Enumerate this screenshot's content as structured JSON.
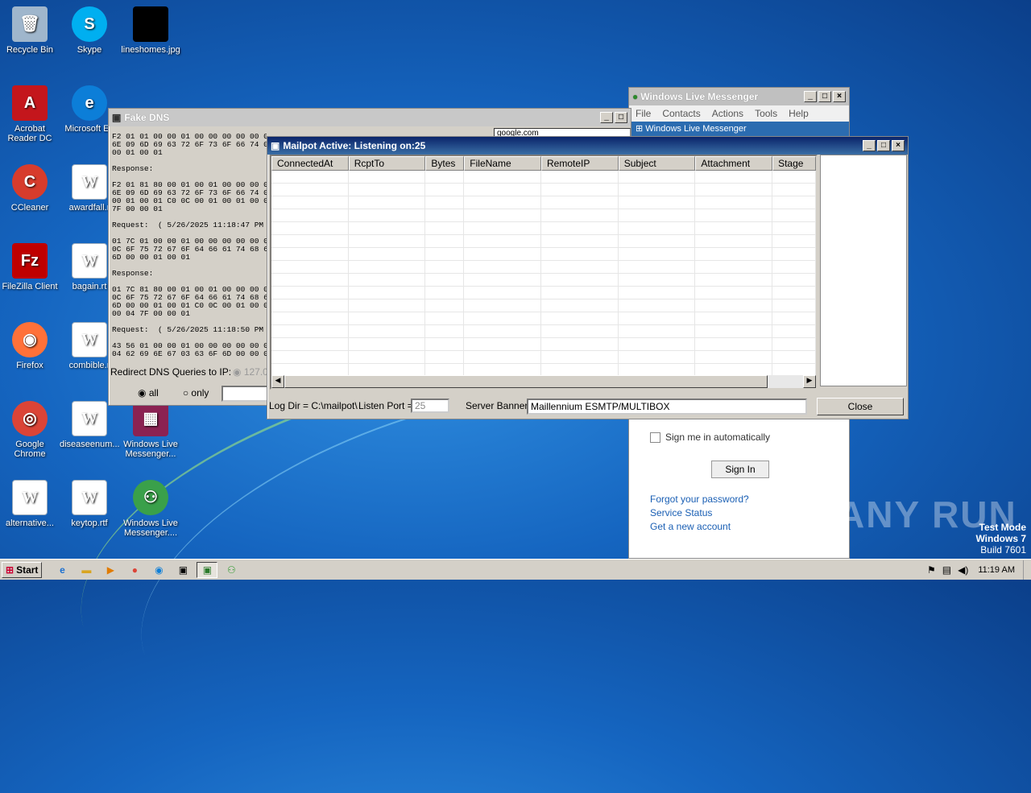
{
  "desktop_icons": [
    {
      "label": "Recycle Bin",
      "icon": "recycle-bin-icon"
    },
    {
      "label": "Skype",
      "icon": "skype-icon"
    },
    {
      "label": "lineshomes.jpg",
      "icon": "image-file-icon"
    },
    {
      "label": "Acrobat Reader DC",
      "icon": "acrobat-icon"
    },
    {
      "label": "Microsoft Ed",
      "icon": "edge-icon"
    },
    {
      "label": "CCleaner",
      "icon": "ccleaner-icon"
    },
    {
      "label": "awardfall.r",
      "icon": "word-doc-icon"
    },
    {
      "label": "FileZilla Client",
      "icon": "filezilla-icon"
    },
    {
      "label": "bagain.rt",
      "icon": "word-doc-icon"
    },
    {
      "label": "Firefox",
      "icon": "firefox-icon"
    },
    {
      "label": "combible.r",
      "icon": "word-doc-icon"
    },
    {
      "label": "Google Chrome",
      "icon": "chrome-icon"
    },
    {
      "label": "diseaseenum...",
      "icon": "word-doc-icon"
    },
    {
      "label": "Windows Live Messenger...",
      "icon": "winrar-icon"
    },
    {
      "label": "alternative...",
      "icon": "word-doc-icon"
    },
    {
      "label": "keytop.rtf",
      "icon": "word-doc-icon"
    },
    {
      "label": "Windows Live Messenger....",
      "icon": "messenger-icon"
    }
  ],
  "messenger": {
    "title": "Windows Live Messenger",
    "menu": [
      "File",
      "Contacts",
      "Actions",
      "Tools",
      "Help"
    ],
    "header": "Windows Live Messenger",
    "sign_in_auto": "Sign me in automatically",
    "sign_in_button": "Sign In",
    "links": [
      "Forgot your password?",
      "Service Status",
      "Get a new account"
    ]
  },
  "fakedns": {
    "title": "Fake DNS",
    "domain_field": "google.com",
    "log": "F2 01 01 00 00 01 00 00 00 00 00 00 06 67 6F\n6E 09 6D 69 63 72 6F 73 6F 66 74 03 63 6F 6D\n00 01 00 01\n\nResponse:\n\nF2 01 81 80 00 01 00 01 00 00 00 00 06 67 6F\n6E 09 6D 69 63 72 6F 73 6F 66 74 03 63 6F 6D\n00 01 00 01 C0 0C 00 01 00 01 00 00 00 3C 00\n7F 00 00 01\n\nRequest:  ( 5/26/2025 11:18:47 PM )\n\n01 7C 01 00 00 01 00 00 00 00 00 00 0B 63 6C\n0C 6F 75 72 67 6F 64 66 61 74 68 65 72 03 63\n6D 00 00 01 00 01\n\nResponse:\n\n01 7C 81 80 00 01 00 01 00 00 00 00 0B 63 6C\n0C 6F 75 72 67 6F 64 66 61 74 68 65 72 03 63\n6D 00 00 01 00 01 C0 0C 00 01 00 01 00 00 00\n00 04 7F 00 00 01\n\nRequest:  ( 5/26/2025 11:18:50 PM )\n\n43 56 01 00 00 01 00 00 00 00 00 00 06 67 6F\n04 62 69 6E 67 03 63 6F 6D 00 00 01 00 01\n\nResponse:\n\n43 56 81 80 00 01 00 01 00 00 00 00 06 67 6F\n04 62 69 6E 67 03 63 6F 6D 00 00 01 00 01 C0\n00 01 00 01 00 00 51 81 00 04 7F 00 00 01",
    "redirect_label": "Redirect DNS Queries to IP:",
    "redirect_ip": "127.0",
    "radio_all": "all",
    "radio_only": "only"
  },
  "mailpot": {
    "title": "Mailpot Active: Listening on:25",
    "columns": [
      "ConnectedAt",
      "RcptTo",
      "Bytes",
      "FileName",
      "RemoteIP",
      "Subject",
      "Attachment",
      "Stage"
    ],
    "log_dir": "Log Dir = C:\\mailpot\\",
    "listen_port_label": "Listen Port =",
    "listen_port": "25",
    "server_banner_label": "Server Banner",
    "server_banner": "Maillennium ESMTP/MULTIBOX",
    "close_button": "Close"
  },
  "watermark": {
    "brand": "ANY RUN",
    "mode": "Test Mode",
    "os": "Windows 7",
    "build": "Build 7601"
  },
  "taskbar": {
    "start": "Start",
    "clock": "11:19 AM"
  }
}
